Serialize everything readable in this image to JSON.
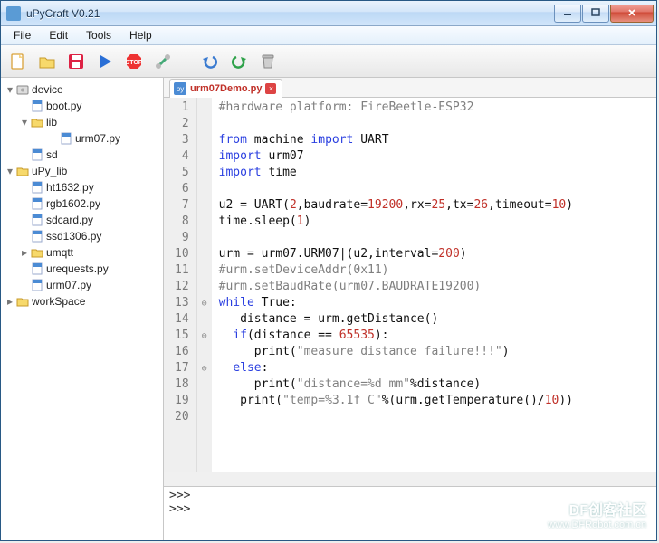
{
  "window": {
    "title": "uPyCraft V0.21"
  },
  "menu": [
    "File",
    "Edit",
    "Tools",
    "Help"
  ],
  "tree": [
    {
      "ind": 0,
      "tw": "down",
      "icon": "disk",
      "label": "device"
    },
    {
      "ind": 1,
      "tw": "none",
      "icon": "py",
      "label": "boot.py"
    },
    {
      "ind": 1,
      "tw": "down",
      "icon": "folder",
      "label": "lib"
    },
    {
      "ind": 3,
      "tw": "none",
      "icon": "py",
      "label": "urm07.py"
    },
    {
      "ind": 1,
      "tw": "none",
      "icon": "py",
      "label": "sd"
    },
    {
      "ind": 0,
      "tw": "down",
      "icon": "folder",
      "label": "uPy_lib"
    },
    {
      "ind": 1,
      "tw": "none",
      "icon": "py",
      "label": "ht1632.py"
    },
    {
      "ind": 1,
      "tw": "none",
      "icon": "py",
      "label": "rgb1602.py"
    },
    {
      "ind": 1,
      "tw": "none",
      "icon": "py",
      "label": "sdcard.py"
    },
    {
      "ind": 1,
      "tw": "none",
      "icon": "py",
      "label": "ssd1306.py"
    },
    {
      "ind": 1,
      "tw": "right",
      "icon": "folder",
      "label": "umqtt"
    },
    {
      "ind": 1,
      "tw": "none",
      "icon": "py",
      "label": "urequests.py"
    },
    {
      "ind": 1,
      "tw": "none",
      "icon": "py",
      "label": "urm07.py"
    },
    {
      "ind": 0,
      "tw": "right",
      "icon": "folder",
      "label": "workSpace"
    }
  ],
  "tab": {
    "name": "urm07Demo.py"
  },
  "code_lines": [
    [
      [
        "com",
        "#hardware platform: FireBeetle-ESP32"
      ]
    ],
    [],
    [
      [
        "kw",
        "from"
      ],
      [
        "id",
        " machine "
      ],
      [
        "kw",
        "import"
      ],
      [
        "id",
        " UART"
      ]
    ],
    [
      [
        "kw",
        "import"
      ],
      [
        "id",
        " urm07"
      ]
    ],
    [
      [
        "kw",
        "import"
      ],
      [
        "id",
        " time"
      ]
    ],
    [],
    [
      [
        "id",
        "u2 = UART("
      ],
      [
        "num",
        "2"
      ],
      [
        "id",
        ",baudrate="
      ],
      [
        "num",
        "19200"
      ],
      [
        "id",
        ",rx="
      ],
      [
        "num",
        "25"
      ],
      [
        "id",
        ",tx="
      ],
      [
        "num",
        "26"
      ],
      [
        "id",
        ",timeout="
      ],
      [
        "num",
        "10"
      ],
      [
        "id",
        ")"
      ]
    ],
    [
      [
        "id",
        "time.sleep("
      ],
      [
        "num",
        "1"
      ],
      [
        "id",
        ")"
      ]
    ],
    [],
    [
      [
        "id",
        "urm = urm07.URM07"
      ],
      [
        "id",
        "|(u2,interval="
      ],
      [
        "num",
        "200"
      ],
      [
        "id",
        ")"
      ]
    ],
    [
      [
        "com",
        "#urm.setDeviceAddr(0x11)"
      ]
    ],
    [
      [
        "com",
        "#urm.setBaudRate(urm07.BAUDRATE19200)"
      ]
    ],
    [
      [
        "kw",
        "while"
      ],
      [
        "id",
        " True:"
      ]
    ],
    [
      [
        "id",
        "   distance = urm.getDistance()"
      ]
    ],
    [
      [
        "id",
        "  "
      ],
      [
        "kw",
        "if"
      ],
      [
        "id",
        "(distance == "
      ],
      [
        "num",
        "65535"
      ],
      [
        "id",
        "):"
      ]
    ],
    [
      [
        "id",
        "     print("
      ],
      [
        "str",
        "\"measure distance failure!!!\""
      ],
      [
        "id",
        ")"
      ]
    ],
    [
      [
        "id",
        "  "
      ],
      [
        "kw",
        "else"
      ],
      [
        "id",
        ":"
      ]
    ],
    [
      [
        "id",
        "     print("
      ],
      [
        "str",
        "\"distance=%d mm\""
      ],
      [
        "id",
        "%distance)"
      ]
    ],
    [
      [
        "id",
        "   print("
      ],
      [
        "str",
        "\"temp=%3.1f C\""
      ],
      [
        "id",
        "%(urm.getTemperature()/"
      ],
      [
        "num",
        "10"
      ],
      [
        "id",
        "))"
      ]
    ],
    []
  ],
  "fold": {
    "13": "⊖",
    "15": "⊖",
    "17": "⊖"
  },
  "console": [
    ">>>",
    ">>>"
  ],
  "watermark": {
    "line1": "DF创客社区",
    "line2": "www.DFRobot.com.cn"
  }
}
